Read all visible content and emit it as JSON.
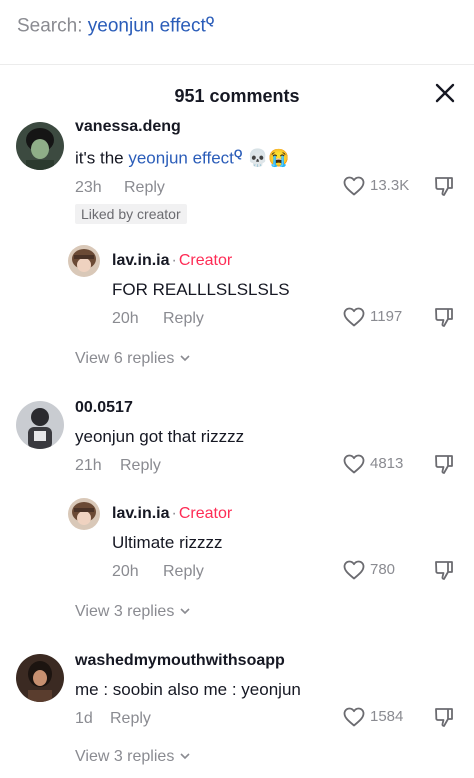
{
  "search": {
    "label": "Search:",
    "term": "yeonjun effect",
    "sup": "Q"
  },
  "header": {
    "title": "951 comments"
  },
  "comments": [
    {
      "username": "vanessa.deng",
      "text_before": "it's the ",
      "text_link": "yeonjun effect",
      "text_sup": "Q",
      "emojis": "💀😭",
      "time": "23h",
      "reply_label": "Reply",
      "badge": "Liked by creator",
      "likes": "13.3K"
    },
    {
      "username": "lav.in.ia",
      "creator_sep": "·",
      "creator_label": "Creator",
      "text": "FOR REALLLSLSLSLS",
      "time": "20h",
      "reply_label": "Reply",
      "likes": "1197",
      "view_replies": "View 6 replies"
    },
    {
      "username": "00.0517",
      "text": "yeonjun got that rizzzz",
      "time": "21h",
      "reply_label": "Reply",
      "likes": "4813"
    },
    {
      "username": "lav.in.ia",
      "creator_sep": "·",
      "creator_label": "Creator",
      "text": "Ultimate rizzzz",
      "time": "20h",
      "reply_label": "Reply",
      "likes": "780",
      "view_replies": "View 3 replies"
    },
    {
      "username": "washedmymouthwithsoapp",
      "text": "me : soobin also me : yeonjun",
      "time": "1d",
      "reply_label": "Reply",
      "likes": "1584",
      "view_replies": "View 3 replies"
    }
  ],
  "colors": {
    "link": "#2b5db9",
    "creator": "#fe2c55",
    "muted": "#8a8b91"
  },
  "icons": [
    "close-icon",
    "heart-icon",
    "dislike-icon",
    "chevron-down-icon"
  ]
}
